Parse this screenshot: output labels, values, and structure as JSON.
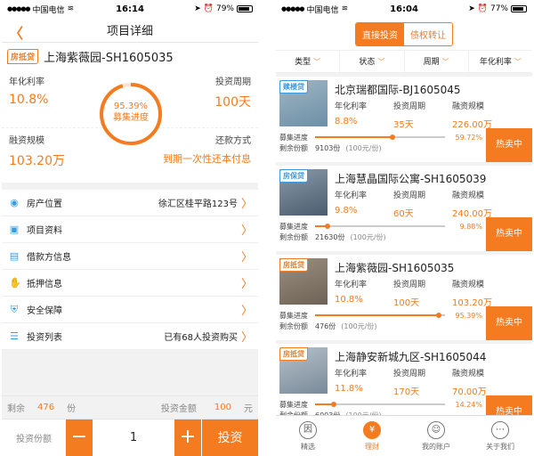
{
  "status_left": {
    "carrier": "中国电信",
    "time": "16:14",
    "battery": "79%"
  },
  "status_right": {
    "carrier": "中国电信",
    "time": "16:04",
    "battery": "77%"
  },
  "detail": {
    "nav_title": "项目详细",
    "tag": "房抵贷",
    "title": "上海紫薇园-SH1605035",
    "rate_label": "年化利率",
    "rate": "10.8%",
    "period_label": "投资周期",
    "period": "100天",
    "scale_label": "融资规模",
    "scale": "103.20万",
    "repay_label": "还款方式",
    "repay": "到期一次性还本付息",
    "progress_pct": "95.39%",
    "progress_label": "募集进度",
    "progress_value": 0.9539,
    "rows": [
      {
        "icon": "location-icon",
        "glyph": "◉",
        "label": "房产位置",
        "value": "徐汇区桂平路123号"
      },
      {
        "icon": "image-icon",
        "glyph": "▣",
        "label": "项目资料",
        "value": ""
      },
      {
        "icon": "document-icon",
        "glyph": "▤",
        "label": "借款方信息",
        "value": ""
      },
      {
        "icon": "hand-icon",
        "glyph": "✋",
        "label": "抵押信息",
        "value": ""
      },
      {
        "icon": "shield-icon",
        "glyph": "⛨",
        "label": "安全保障",
        "value": ""
      },
      {
        "icon": "list-icon",
        "glyph": "☰",
        "label": "投资列表",
        "value": "已有68人投资购买"
      }
    ],
    "remain_label": "剩余",
    "remain_count": "476",
    "remain_unit": "份",
    "amount_label": "投资金额",
    "amount": "100",
    "amount_unit": "元",
    "qty_label": "投资份额",
    "minus": "−",
    "qty": "1",
    "plus": "+",
    "invest": "投资"
  },
  "list": {
    "seg": [
      "直接投资",
      "债权转让"
    ],
    "filters": [
      "类型",
      "状态",
      "周期",
      "年化利率"
    ],
    "col_labels": [
      "年化利率",
      "投资周期",
      "融资规模"
    ],
    "progress_label": "募集进度",
    "remain_label": "剩余份额",
    "unit_note": "(100元/份)",
    "hot": "热卖中",
    "items": [
      {
        "tag": "赎楼贷",
        "tag_color": "#3a9be0",
        "name": "北京瑞都国际-BJ1605045",
        "rate": "8.8%",
        "period": "35天",
        "scale": "226.00万",
        "pct": "59.72%",
        "progress": 0.5972,
        "remain": "9103份"
      },
      {
        "tag": "房保贷",
        "tag_color": "#3a9be0",
        "name": "上海慧晶国际公寓-SH1605039",
        "rate": "9.8%",
        "period": "60天",
        "scale": "240.00万",
        "pct": "9.88%",
        "progress": 0.0988,
        "remain": "21630份"
      },
      {
        "tag": "房抵贷",
        "tag_color": "#f47b20",
        "name": "上海紫薇园-SH1605035",
        "rate": "10.8%",
        "period": "100天",
        "scale": "103.20万",
        "pct": "95.39%",
        "progress": 0.9539,
        "remain": "476份"
      },
      {
        "tag": "房抵贷",
        "tag_color": "#f47b20",
        "name": "上海静安新城九区-SH1605044",
        "rate": "11.8%",
        "period": "170天",
        "scale": "70.00万",
        "pct": "14.24%",
        "progress": 0.1424,
        "remain": "6003份"
      }
    ],
    "tabs": [
      {
        "icon": "featured-icon",
        "glyph": "因",
        "label": "精选"
      },
      {
        "icon": "finance-icon",
        "glyph": "¥",
        "label": "理财"
      },
      {
        "icon": "account-icon",
        "glyph": "☺",
        "label": "我的账户"
      },
      {
        "icon": "more-icon",
        "glyph": "⋯",
        "label": "关于我们"
      }
    ]
  }
}
